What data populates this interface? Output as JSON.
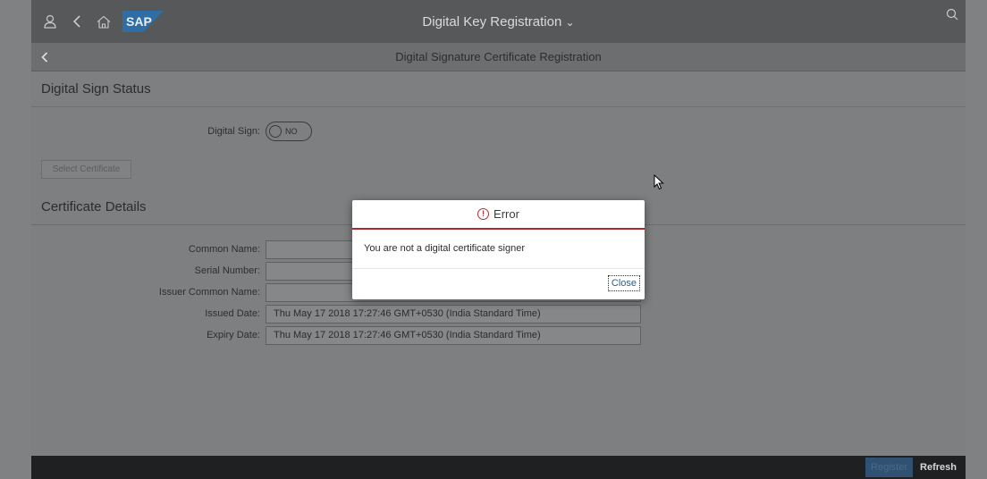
{
  "shell": {
    "title": "Digital Key Registration",
    "logo_text": "SAP"
  },
  "page": {
    "title": "Digital Signature Certificate Registration"
  },
  "status_section": {
    "title": "Digital Sign Status",
    "digital_sign_label": "Digital Sign:",
    "digital_sign_value": "NO",
    "select_certificate_label": "Select Certificate"
  },
  "details_section": {
    "title": "Certificate Details",
    "fields": [
      {
        "label": "Common Name:",
        "value": ""
      },
      {
        "label": "Serial Number:",
        "value": ""
      },
      {
        "label": "Issuer Common Name:",
        "value": ""
      },
      {
        "label": "Issued Date:",
        "value": "Thu May 17 2018 17:27:46 GMT+0530 (India Standard Time)"
      },
      {
        "label": "Expiry Date:",
        "value": "Thu May 17 2018 17:27:46 GMT+0530 (India Standard Time)"
      }
    ]
  },
  "footer": {
    "register_label": "Register",
    "refresh_label": "Refresh"
  },
  "dialog": {
    "title": "Error",
    "message": "You are not a digital certificate signer",
    "close_label": "Close"
  },
  "colors": {
    "error": "#c4282a",
    "shell_bg": "#56585a",
    "overlay": "#7f8183",
    "footer_bg": "#1e2021"
  }
}
